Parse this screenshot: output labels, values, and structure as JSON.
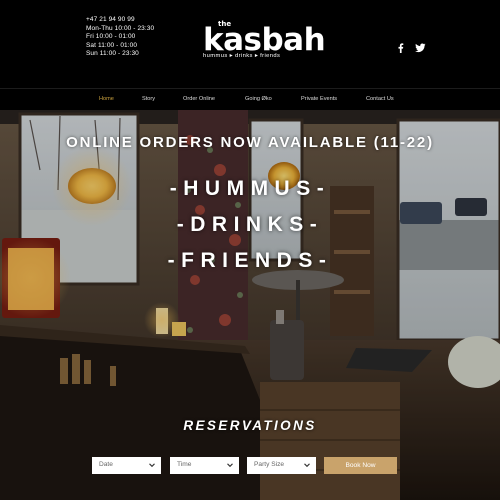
{
  "hours": [
    "+47 21 94 90 99",
    "Mon-Thu 10:00 - 23:30",
    "Fri 10:00 - 01:00",
    "Sat 11:00 - 01:00",
    "Sun 11:00 - 23:30"
  ],
  "logo": {
    "small": "the",
    "name": "kasbah",
    "tagline": "hummus ▸ drinks ▸ friends"
  },
  "social": [
    {
      "name": "facebook-icon",
      "glyph": "f"
    },
    {
      "name": "twitter-icon",
      "glyph": "t"
    }
  ],
  "nav": {
    "active": "Home",
    "items": [
      "Home",
      "Story",
      "Order Online",
      "Going Øko",
      "Private Events",
      "Contact Us"
    ]
  },
  "hero": {
    "headline": "ONLINE ORDERS NOW AVAILABLE (11-22)",
    "taglines": [
      "-HUMMUS-",
      "-DRINKS-",
      "-FRIENDS-"
    ]
  },
  "reservations": {
    "title": "RESERVATIONS",
    "date_placeholder": "Date",
    "time_placeholder": "Time",
    "party_placeholder": "Party Size",
    "book_label": "Book Now"
  },
  "colors": {
    "accent": "#c9a13f",
    "button": "#c9a36b",
    "background": "#000000"
  }
}
